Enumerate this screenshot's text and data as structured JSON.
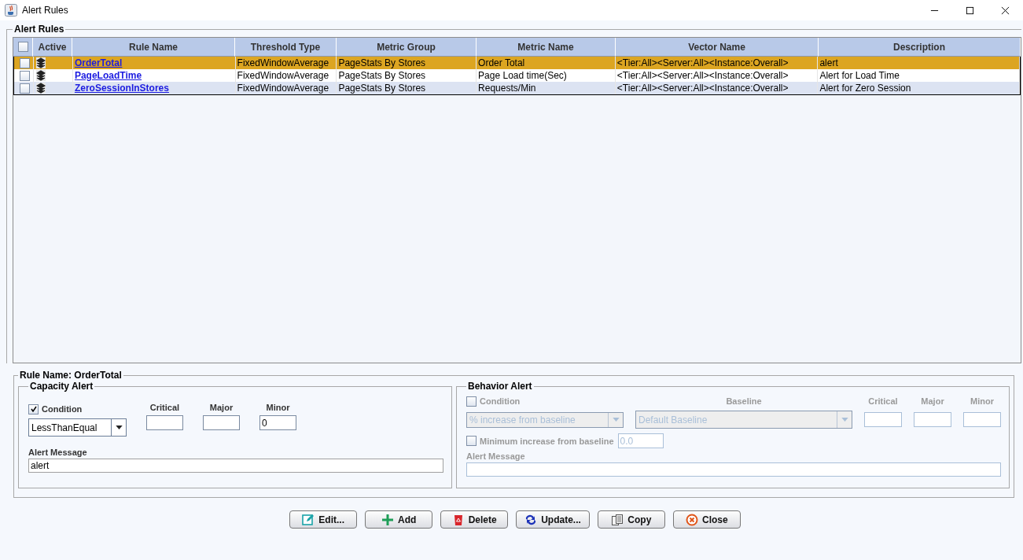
{
  "window": {
    "title": "Alert Rules"
  },
  "group_title": "Alert Rules",
  "table": {
    "header_checkbox": {
      "checked": false
    },
    "active_column": "Active",
    "columns": [
      "Rule Name",
      "Threshold Type",
      "Metric Group",
      "Metric Name",
      "Vector Name",
      "Description"
    ],
    "rows": [
      {
        "checked": false,
        "selected": true,
        "cells": [
          "OrderTotal",
          "FixedWindowAverage",
          "PageStats By Stores",
          "Order Total",
          "<Tier:All><Server:All><Instance:Overall>",
          "alert"
        ]
      },
      {
        "checked": false,
        "selected": false,
        "cells": [
          "PageLoadTime",
          "FixedWindowAverage",
          "PageStats By Stores",
          "Page Load time(Sec)",
          "<Tier:All><Server:All><Instance:Overall>",
          "Alert for Load Time"
        ]
      },
      {
        "checked": false,
        "selected": false,
        "cells": [
          "ZeroSessionInStores",
          "FixedWindowAverage",
          "PageStats By Stores",
          "Requests/Min",
          "<Tier:All><Server:All><Instance:Overall>",
          "Alert for Zero Session"
        ]
      }
    ]
  },
  "detail": {
    "title": "Rule Name: OrderTotal",
    "capacity_alert": {
      "title": "Capacity Alert",
      "disabled": false,
      "condition": {
        "label": "Condition",
        "checked": true
      },
      "operator": "LessThanEqual",
      "thresholds": [
        {
          "label": "Critical"
        },
        {
          "label": "Major"
        },
        {
          "label": "Minor",
          "value": "0"
        }
      ],
      "message_label": "Alert Message",
      "message": "alert"
    },
    "behavior_alert": {
      "title": "Behavior Alert",
      "disabled": true,
      "condition": {
        "label": "Condition",
        "checked": false
      },
      "baseline_label": "Baseline",
      "type": "% increase from baseline",
      "baseline": "Default Baseline",
      "thresholds": [
        {
          "label": "Critical"
        },
        {
          "label": "Major"
        },
        {
          "label": "Minor"
        }
      ],
      "minimum": {
        "label": "Minimum increase from baseline",
        "checked": false,
        "value": "0.0"
      },
      "message_label": "Alert Message"
    }
  },
  "buttons": [
    {
      "label": "Edit...",
      "kind": "edit"
    },
    {
      "label": "Add",
      "kind": "add"
    },
    {
      "label": "Delete",
      "kind": "delete"
    },
    {
      "label": "Update...",
      "kind": "update"
    },
    {
      "label": "Copy",
      "kind": "copy"
    },
    {
      "label": "Close",
      "kind": "close"
    }
  ]
}
